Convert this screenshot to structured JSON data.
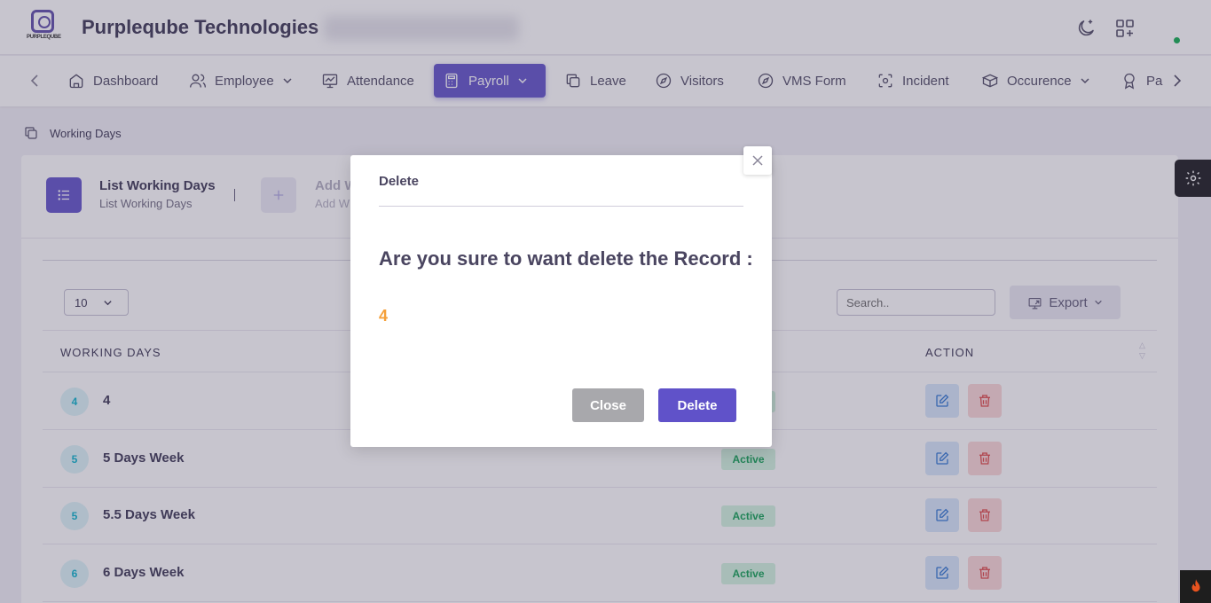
{
  "header": {
    "logo_text": "PURPLEQUBE",
    "company": "Purpleqube Technologies",
    "theme_icon": "moon-icon",
    "apps_icon": "grid-plus-icon"
  },
  "nav": {
    "items": [
      {
        "label": "Dashboard",
        "icon": "home-icon"
      },
      {
        "label": "Employee",
        "icon": "users-icon",
        "dropdown": true
      },
      {
        "label": "Attendance",
        "icon": "monitor-chart-icon"
      },
      {
        "label": "Payroll",
        "icon": "calculator-icon",
        "dropdown": true,
        "active": true
      },
      {
        "label": "Leave",
        "icon": "copy-icon"
      },
      {
        "label": "Visitors",
        "icon": "compass-icon"
      },
      {
        "label": "VMS Form",
        "icon": "compass-icon"
      },
      {
        "label": "Incident",
        "icon": "focus-icon"
      },
      {
        "label": "Occurence",
        "icon": "layers-icon",
        "dropdown": true
      },
      {
        "label": "Pa",
        "icon": "award-icon"
      }
    ]
  },
  "breadcrumb": {
    "label": "Working Days"
  },
  "tabs": {
    "list_title": "List Working Days",
    "list_sub": "List Working Days",
    "add_title": "Add W",
    "add_sub": "Add W"
  },
  "table": {
    "page_size": "10",
    "search_placeholder": "Search..",
    "export_label": "Export",
    "col_days": "WORKING DAYS",
    "col_action": "ACTION",
    "rows": [
      {
        "badge": "4",
        "label": "4",
        "status": ""
      },
      {
        "badge": "5",
        "label": "5 Days Week",
        "status": "Active"
      },
      {
        "badge": "5",
        "label": "5.5 Days Week",
        "status": "Active"
      },
      {
        "badge": "6",
        "label": "6 Days Week",
        "status": "Active"
      }
    ]
  },
  "modal": {
    "title": "Delete",
    "question": "Are you sure to want delete the Record :",
    "record": "4",
    "close_label": "Close",
    "delete_label": "Delete"
  },
  "colors": {
    "accent": "#6c5fce",
    "delete_button": "#6052c9",
    "close_button": "#a8a8ac",
    "record_highlight": "#f5a03a",
    "active_status": "#22a861"
  }
}
